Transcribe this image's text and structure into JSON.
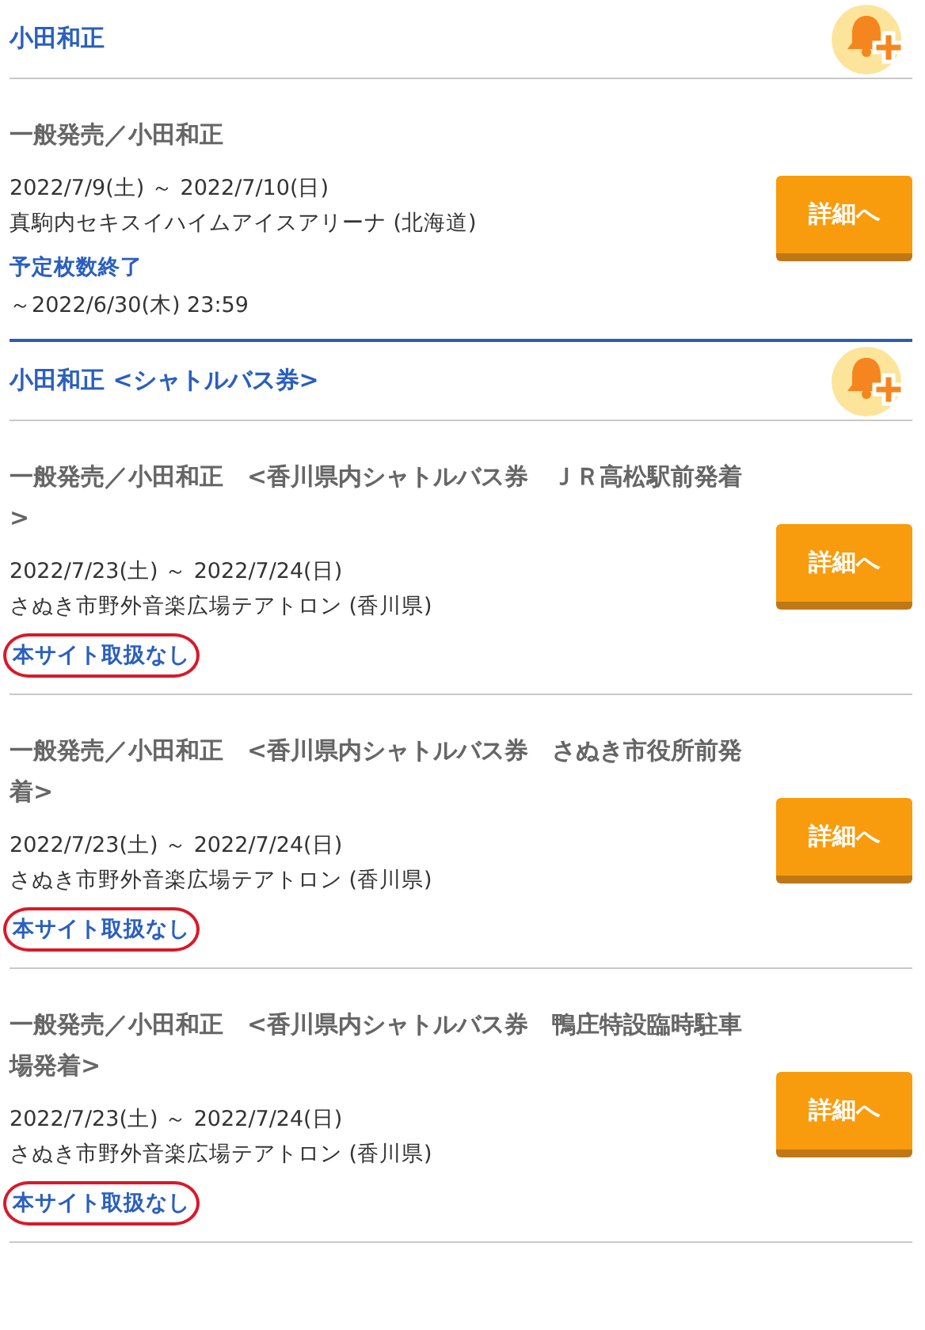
{
  "sections": [
    {
      "heading": "小田和正",
      "items": [
        {
          "title": "一般発売／小田和正",
          "dates": "2022/7/9(土) ～ 2022/7/10(日)",
          "venue": "真駒内セキスイハイムアイスアリーナ (北海道)",
          "status": "予定枚数終了",
          "highlighted": false,
          "deadline": "～2022/6/30(木) 23:59",
          "button": "詳細へ"
        }
      ]
    },
    {
      "heading": "小田和正 <シャトルバス券>",
      "items": [
        {
          "title": "一般発売／小田和正　<香川県内シャトルバス券　ＪＲ高松駅前発着>",
          "dates": "2022/7/23(土) ～ 2022/7/24(日)",
          "venue": "さぬき市野外音楽広場テアトロン (香川県)",
          "status": "本サイト取扱なし",
          "highlighted": true,
          "button": "詳細へ"
        },
        {
          "title": "一般発売／小田和正　<香川県内シャトルバス券　さぬき市役所前発着>",
          "dates": "2022/7/23(土) ～ 2022/7/24(日)",
          "venue": "さぬき市野外音楽広場テアトロン (香川県)",
          "status": "本サイト取扱なし",
          "highlighted": true,
          "button": "詳細へ"
        },
        {
          "title": "一般発売／小田和正　<香川県内シャトルバス券　鴨庄特設臨時駐車場発着>",
          "dates": "2022/7/23(土) ～ 2022/7/24(日)",
          "venue": "さぬき市野外音楽広場テアトロン (香川県)",
          "status": "本サイト取扱なし",
          "highlighted": true,
          "button": "詳細へ"
        }
      ]
    }
  ]
}
